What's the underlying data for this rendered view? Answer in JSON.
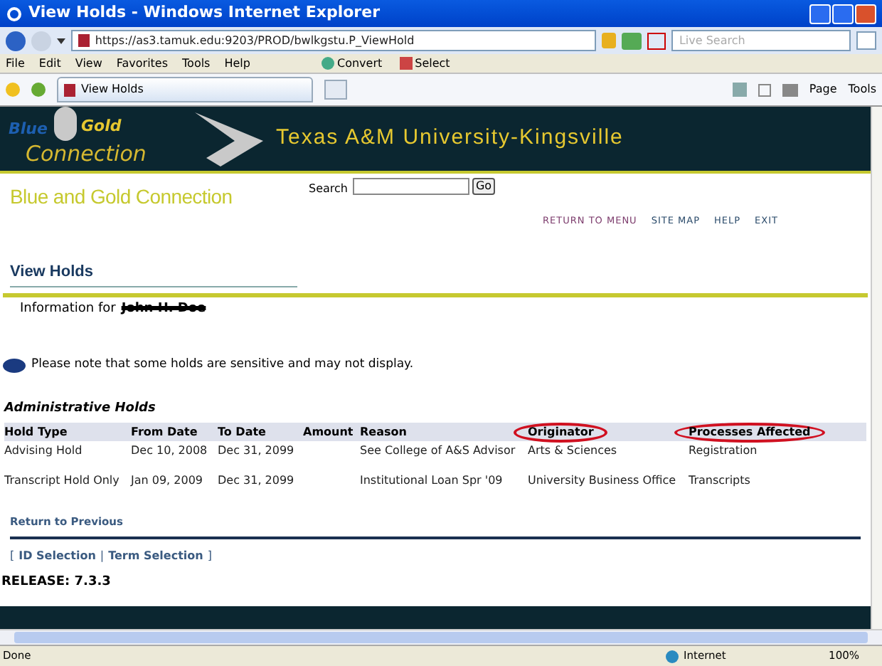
{
  "window": {
    "title": "View Holds - Windows Internet Explorer"
  },
  "address_bar": {
    "url": "https://as3.tamuk.edu:9203/PROD/bwlkgstu.P_ViewHold",
    "search_placeholder": "Live Search"
  },
  "menu": [
    "File",
    "Edit",
    "View",
    "Favorites",
    "Tools",
    "Help"
  ],
  "toolbar": [
    {
      "label": "Convert",
      "kind": "convert"
    },
    {
      "label": "Select",
      "kind": "select"
    }
  ],
  "tab": {
    "label": "View Holds"
  },
  "command_bar": [
    {
      "label": "Page"
    },
    {
      "label": "Tools"
    }
  ],
  "banner": {
    "logo": [
      "Blue",
      "Gold",
      "Connection"
    ],
    "title": "Texas A&M University-Kingsville"
  },
  "site_title": "Blue and Gold Connection",
  "search": {
    "label": "Search",
    "button": "Go"
  },
  "nav_links": [
    "RETURN TO MENU",
    "SITE MAP",
    "HELP",
    "EXIT"
  ],
  "page_title": "View Holds",
  "info": {
    "label": "Information for",
    "name": "John H. Doe",
    "struck": true
  },
  "note": "Please note that some holds are sensitive and may not display.",
  "section_title": "Administrative Holds",
  "table": {
    "columns": [
      {
        "label": "Hold Type",
        "circled": false
      },
      {
        "label": "From Date",
        "circled": false
      },
      {
        "label": "To Date",
        "circled": false
      },
      {
        "label": "Amount",
        "circled": false
      },
      {
        "label": "Reason",
        "circled": false
      },
      {
        "label": "Originator",
        "circled": true
      },
      {
        "label": "Processes Affected",
        "circled": true
      }
    ],
    "rows": [
      [
        "Advising Hold",
        "Dec 10, 2008",
        "Dec 31, 2099",
        "",
        "See College of A&S Advisor",
        "Arts & Sciences",
        "Registration"
      ],
      [
        "Transcript Hold Only",
        "Jan 09, 2009",
        "Dec 31, 2099",
        "",
        "Institutional Loan Spr '09",
        "University Business Office",
        "Transcripts"
      ]
    ]
  },
  "return_link": "Return to Previous",
  "selection_links": [
    "ID Selection",
    "Term Selection"
  ],
  "selection_punctuation": {
    "open": "[",
    "separator": "|",
    "close": "]"
  },
  "release": "RELEASE: 7.3.3",
  "status_bar": {
    "text": "Done",
    "zone": "Internet",
    "zoom": "100%"
  }
}
